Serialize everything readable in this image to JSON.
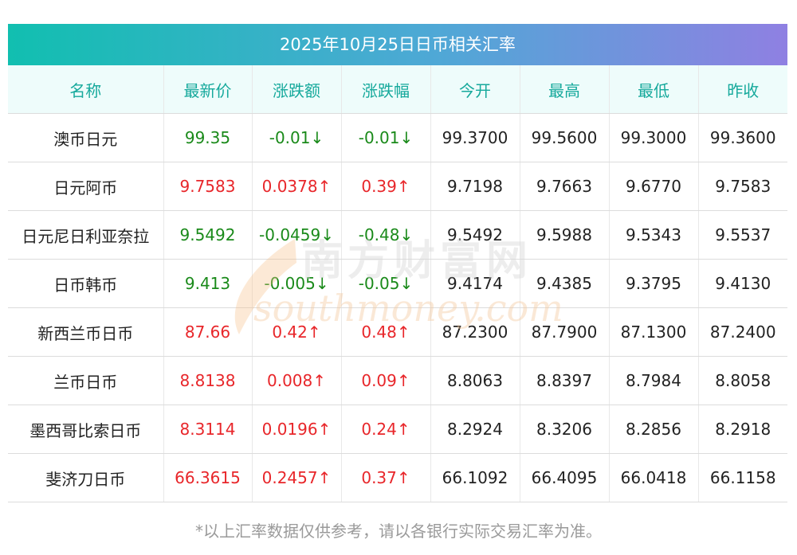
{
  "title": "2025年10月25日日币相关汇率",
  "columns": [
    "名称",
    "最新价",
    "涨跌额",
    "涨跌幅",
    "今开",
    "最高",
    "最低",
    "昨收"
  ],
  "rows": [
    {
      "name": "澳币日元",
      "latest": "99.35",
      "change": "-0.01↓",
      "pct": "-0.01↓",
      "open": "99.3700",
      "high": "99.5600",
      "low": "99.3000",
      "prev": "99.3600",
      "trend": "down"
    },
    {
      "name": "日元阿币",
      "latest": "9.7583",
      "change": "0.0378↑",
      "pct": "0.39↑",
      "open": "9.7198",
      "high": "9.7663",
      "low": "9.6770",
      "prev": "9.7583",
      "trend": "up"
    },
    {
      "name": "日元尼日利亚奈拉",
      "latest": "9.5492",
      "change": "-0.0459↓",
      "pct": "-0.48↓",
      "open": "9.5492",
      "high": "9.5988",
      "low": "9.5343",
      "prev": "9.5537",
      "trend": "down"
    },
    {
      "name": "日币韩币",
      "latest": "9.413",
      "change": "-0.005↓",
      "pct": "-0.05↓",
      "open": "9.4174",
      "high": "9.4385",
      "low": "9.3795",
      "prev": "9.4130",
      "trend": "down"
    },
    {
      "name": "新西兰币日币",
      "latest": "87.66",
      "change": "0.42↑",
      "pct": "0.48↑",
      "open": "87.2300",
      "high": "87.7900",
      "low": "87.1300",
      "prev": "87.2400",
      "trend": "up"
    },
    {
      "name": "兰币日币",
      "latest": "8.8138",
      "change": "0.008↑",
      "pct": "0.09↑",
      "open": "8.8063",
      "high": "8.8397",
      "low": "8.7984",
      "prev": "8.8058",
      "trend": "up"
    },
    {
      "name": "墨西哥比索日币",
      "latest": "8.3114",
      "change": "0.0196↑",
      "pct": "0.24↑",
      "open": "8.2924",
      "high": "8.3206",
      "low": "8.2856",
      "prev": "8.2918",
      "trend": "up"
    },
    {
      "name": "斐济刀日币",
      "latest": "66.3615",
      "change": "0.2457↑",
      "pct": "0.37↑",
      "open": "66.1092",
      "high": "66.4095",
      "low": "66.0418",
      "prev": "66.1158",
      "trend": "up"
    }
  ],
  "watermark": {
    "cn": "南方财富网",
    "en": "southmoney.com"
  },
  "footnote": "*以上汇率数据仅供参考，请以各银行实际交易汇率为准。",
  "colors": {
    "up": "#e8262a",
    "down": "#1a8a1a",
    "header_text": "#16a99c",
    "header_bg": "#eefcfb"
  }
}
